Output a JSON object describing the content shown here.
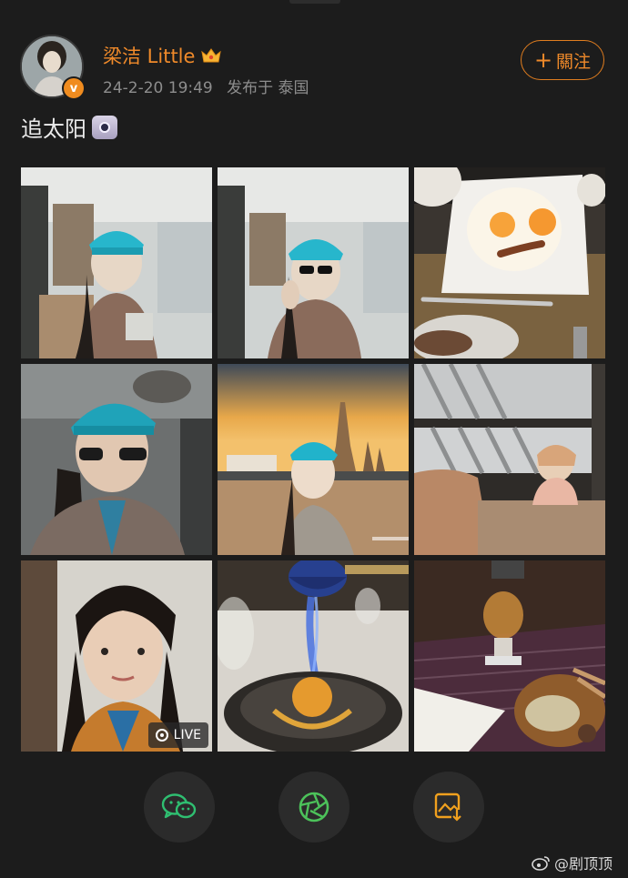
{
  "user": {
    "name": "梁洁 Little",
    "date": "24-2-20 19:49",
    "location": "发布于 泰国",
    "verified_glyph": "v"
  },
  "follow_button": {
    "label": "關注"
  },
  "post": {
    "text": "追太阳"
  },
  "grid": {
    "photos": [
      {
        "name": "photo-1-selfie-lobby"
      },
      {
        "name": "photo-2-selfie-sunglasses"
      },
      {
        "name": "photo-3-smiley-breakfast"
      },
      {
        "name": "photo-4-selfie-car"
      },
      {
        "name": "photo-5-sunset-temple"
      },
      {
        "name": "photo-6-child-window"
      },
      {
        "name": "photo-7-selfie-closeup"
      },
      {
        "name": "photo-8-flambe-dessert"
      },
      {
        "name": "photo-9-coffee-siphon"
      }
    ],
    "live_label": "LIVE"
  },
  "share_buttons": [
    {
      "name": "wechat-share",
      "color": "#2fbf71"
    },
    {
      "name": "moments-share",
      "color": "#4cc25a"
    },
    {
      "name": "save-image",
      "color": "#f0a01e"
    }
  ],
  "watermark": {
    "text": "@剧顶顶"
  }
}
